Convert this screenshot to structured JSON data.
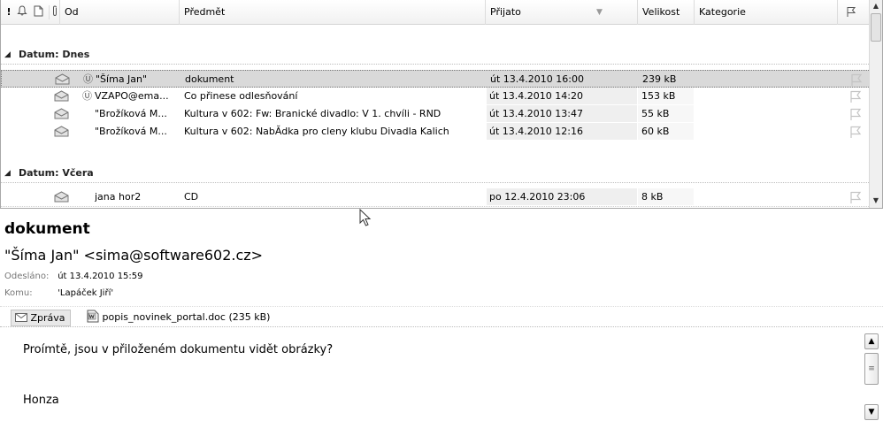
{
  "list": {
    "headers": {
      "importance": "!",
      "from": "Od",
      "subject": "Předmět",
      "received": "Přijato",
      "size": "Velikost",
      "category": "Kategorie"
    },
    "groups": [
      {
        "label": "Datum: Dnes",
        "rows": [
          {
            "from": "\"Šíma Jan\"",
            "subject": "dokument",
            "received": "út 13.4.2010 16:00",
            "size": "239 kB",
            "attachment": true,
            "selected": true
          },
          {
            "from": "VZAPO@ema...",
            "subject": "Co přinese odlesňování",
            "received": "út 13.4.2010 14:20",
            "size": "153 kB",
            "attachment": true,
            "selected": false
          },
          {
            "from": "\"Brožíková M...",
            "subject": "Kultura v 602: Fw: Branické divadlo: V 1. chvíli - RND",
            "received": "út 13.4.2010 13:47",
            "size": "55 kB",
            "attachment": false,
            "selected": false
          },
          {
            "from": "\"Brožíková M...",
            "subject": "Kultura v 602: NabĂ­dka pro cleny klubu Divadla Kalich",
            "received": "út 13.4.2010 12:16",
            "size": "60 kB",
            "attachment": false,
            "selected": false
          }
        ]
      },
      {
        "label": "Datum: Včera",
        "rows": [
          {
            "from": "jana hor2",
            "subject": "CD",
            "received": "po 12.4.2010 23:06",
            "size": "8 kB",
            "attachment": false,
            "selected": false
          }
        ]
      }
    ]
  },
  "preview": {
    "subject": "dokument",
    "from": "\"Šíma Jan\" <sima@software602.cz>",
    "sent_label": "Odesláno:",
    "sent_value": "út 13.4.2010 15:59",
    "to_label": "Komu:",
    "to_value": "'Lapáček Jiří'",
    "message_tab": "Zpráva",
    "attachment": "popis_novinek_portal.doc (235 kB)",
    "body": [
      "Proímtě, jsou v přiloženém dokumentu vidět obrázky?",
      "Honza"
    ]
  },
  "icons": [
    "bell-icon",
    "document-icon",
    "attachment-icon",
    "envelope-icon",
    "flag-icon",
    "sort-arrow-icon",
    "mail-icon",
    "word-doc-icon",
    "mouse-cursor-icon"
  ]
}
